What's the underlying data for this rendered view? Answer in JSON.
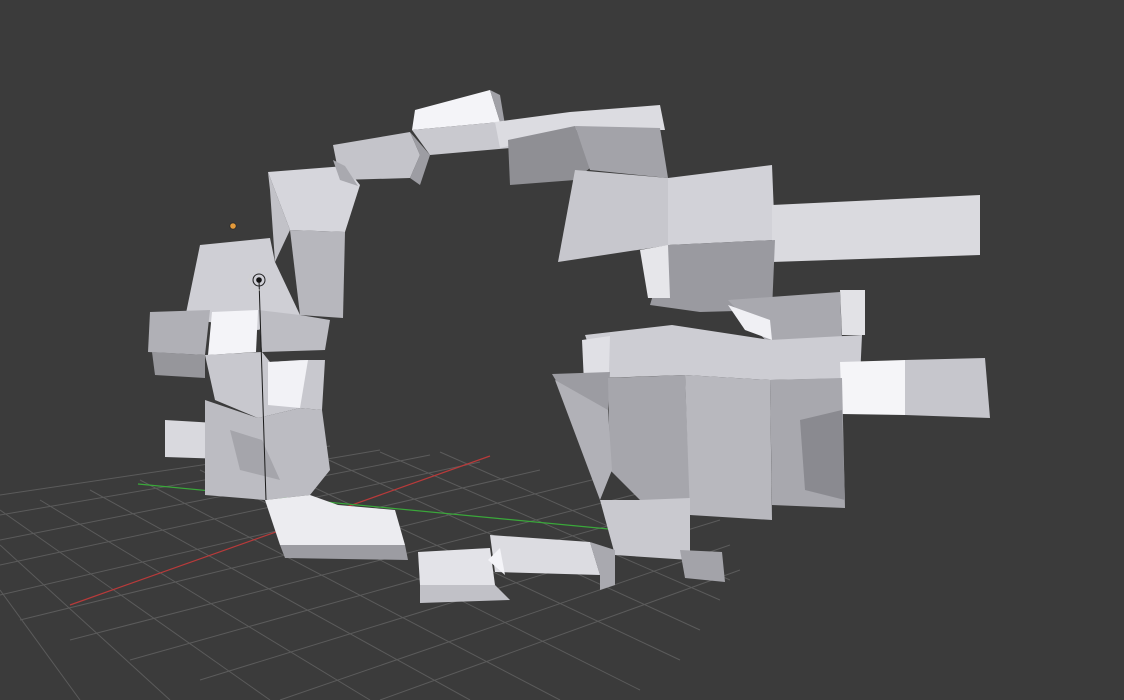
{
  "viewport": {
    "background": "#3b3b3b",
    "grid_color": "#5a5a5a",
    "x_axis_color": "#b83a3a",
    "y_axis_color": "#3aa83a",
    "light_color": "#e39a3a",
    "cursor_color": "#111111"
  },
  "scene": {
    "object": "mesh-ring",
    "mesh_colors": {
      "highlight": "#f4f4f8",
      "light": "#d6d6dc",
      "mid": "#b7b7bd",
      "dark": "#8f8f94",
      "shadow": "#7a7a80"
    }
  },
  "icons": {
    "light": "lamp-icon",
    "cursor": "3d-cursor-icon"
  }
}
